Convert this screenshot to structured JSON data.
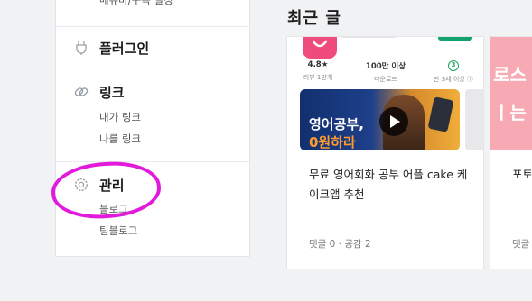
{
  "sidebar": {
    "cut_text": "메뉴바/구독 설정",
    "sections": [
      {
        "title": "플러그인",
        "icon": "plug-icon",
        "items": []
      },
      {
        "title": "링크",
        "icon": "link-icon",
        "items": [
          "내가 링크",
          "나를 링크"
        ]
      },
      {
        "title": "관리",
        "icon": "gear-icon",
        "items": [
          "블로그",
          "팀블로그"
        ]
      }
    ]
  },
  "main": {
    "section_title": "최근 글",
    "posts": [
      {
        "app_stats": [
          {
            "value": "4.8★",
            "label": "리뷰 1만개"
          },
          {
            "value": "100만 이상",
            "label": "다운로드"
          },
          {
            "value": "3",
            "label": "만 3세 이상 ⓘ"
          }
        ],
        "banner_line1": "영어공부,",
        "banner_line2": "0원하라",
        "title": "무료 영어회화 공부 어플 cake 케이크앱 추천",
        "meta": "댓글 0 · 공감 2"
      },
      {
        "banner_line1": "로스",
        "banner_line2": "ㅣ는",
        "title": "포토 짤 설",
        "meta": "댓글"
      }
    ]
  },
  "colors": {
    "annotation": "#e11adc",
    "app_pink": "#f04b7d",
    "green": "#12a36c"
  }
}
